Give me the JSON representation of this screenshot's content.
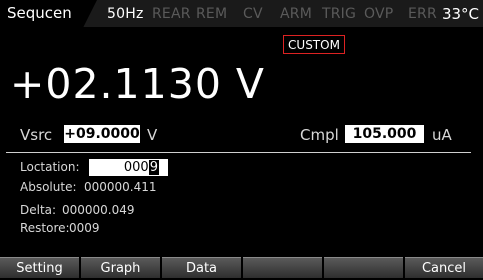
{
  "top_bar": {
    "mode": "Sequcen",
    "frequency": "50Hz",
    "indicators": [
      "REAR",
      "REM",
      "CV",
      "ARM",
      "TRIG",
      "OVP",
      "ERR"
    ],
    "temperature": "33°C"
  },
  "custom_tag": "CUSTOM",
  "reading": "+02.1130 V",
  "source": {
    "label": "Vsrc",
    "value": "+09.0000",
    "unit": "V"
  },
  "compliance": {
    "label": "Cmpl",
    "value": "105.000",
    "unit": "uA"
  },
  "location": {
    "label": "Loctation:",
    "value_prefix": "000",
    "value_cursor": "9"
  },
  "absolute": {
    "label": "Absolute:",
    "value": "000000.411"
  },
  "delta": {
    "label": "Delta:",
    "value": "000000.049"
  },
  "restore": {
    "label": "Restore:",
    "value": "0009"
  },
  "softkeys": [
    "Setting",
    "Graph",
    "Data",
    "",
    "",
    "Cancel"
  ]
}
